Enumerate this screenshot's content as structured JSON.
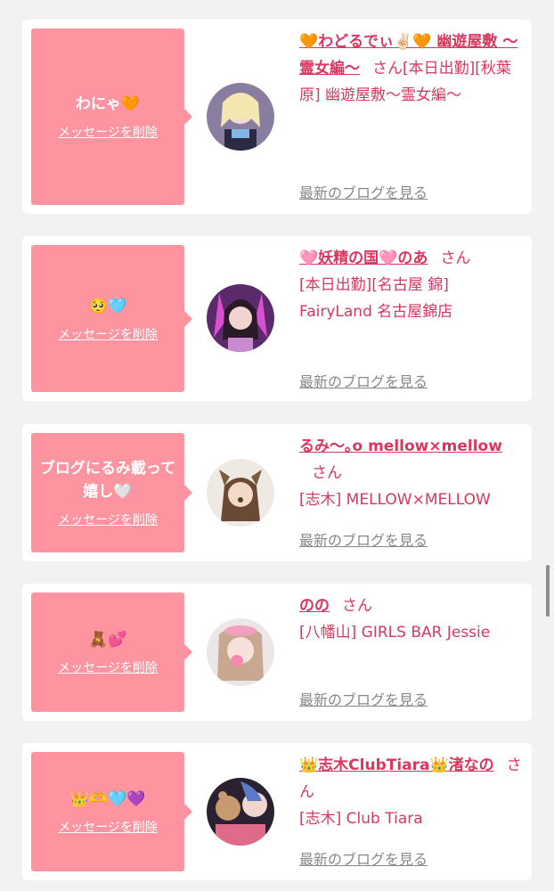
{
  "cards": [
    {
      "message": "わにゃ🧡",
      "delete_label": "メッセージを削除",
      "name": "🧡わどるでぃ✌🏻🧡 幽遊屋敷 〜霊女編〜",
      "san": "さん",
      "shop": "[本日出勤][秋葉原] 幽遊屋敷〜霊女編〜",
      "blog_label": "最新のブログを見る"
    },
    {
      "message": "🥺🩵",
      "delete_label": "メッセージを削除",
      "name": "🩷妖精の国🩷のあ",
      "san": "さん",
      "shop": "[本日出勤][名古屋 錦] FairyLand 名古屋錦店",
      "blog_label": "最新のブログを見る"
    },
    {
      "message": "ブログにるみ載って嬉し🤍",
      "delete_label": "メッセージを削除",
      "name": "るみ〜｡o mellow×mellow",
      "san": "さん",
      "shop": "[志木] MELLOW×MELLOW",
      "blog_label": "最新のブログを見る"
    },
    {
      "message": "🧸💕",
      "delete_label": "メッセージを削除",
      "name": "のの",
      "san": "さん",
      "shop": "[八幡山] GIRLS BAR Jessie",
      "blog_label": "最新のブログを見る"
    },
    {
      "message": "👑🫶🩵💜",
      "delete_label": "メッセージを削除",
      "name": "👑志木ClubTiara👑渚なの",
      "san": "さん",
      "shop": "[志木] Club Tiara",
      "blog_label": "最新のブログを見る"
    }
  ],
  "colors": {
    "bubble": "#fd949f",
    "accent": "#d9375e",
    "link_gray": "#888888",
    "page_bg": "#f2f2f2"
  }
}
